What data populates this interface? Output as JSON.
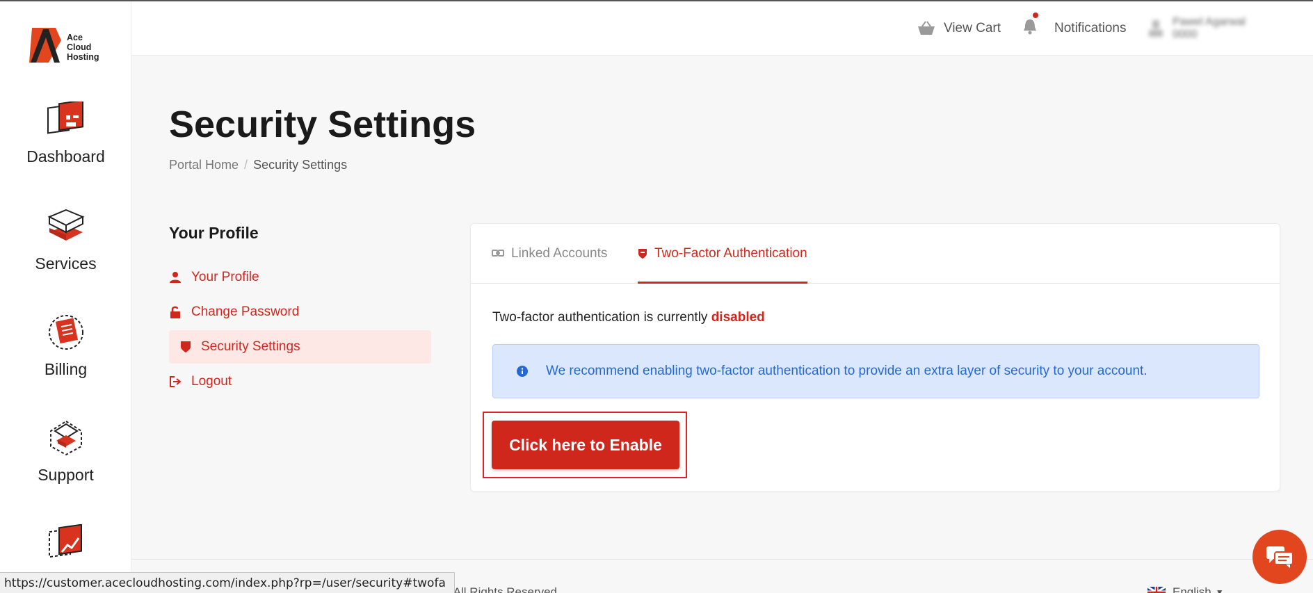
{
  "brand": {
    "logo_lines": [
      "Ace",
      "Cloud",
      "Hosting"
    ],
    "accent": "#d0271d"
  },
  "sidebar": {
    "items": [
      {
        "label": "Dashboard",
        "icon": "dashboard-icon"
      },
      {
        "label": "Services",
        "icon": "services-icon"
      },
      {
        "label": "Billing",
        "icon": "billing-icon"
      },
      {
        "label": "Support",
        "icon": "support-icon"
      },
      {
        "label": "",
        "icon": "reports-icon"
      }
    ]
  },
  "header": {
    "cart_label": "View Cart",
    "notifications_label": "Notifications",
    "user_name": "Pawel Agarwal",
    "user_sub": "0000"
  },
  "page": {
    "title": "Security Settings",
    "breadcrumb": [
      "Portal Home",
      "Security Settings"
    ]
  },
  "profile_menu": {
    "heading": "Your Profile",
    "items": [
      "Your Profile",
      "Change Password",
      "Security Settings",
      "Logout"
    ],
    "active_index": 2
  },
  "card": {
    "tabs": [
      "Linked Accounts",
      "Two-Factor Authentication"
    ],
    "active_tab": 1,
    "status_prefix": "Two-factor authentication is currently",
    "status_value": "disabled",
    "alert_text": "We recommend enabling two-factor authentication to provide an extra layer of security to your account.",
    "enable_button": "Click here to Enable"
  },
  "footer": {
    "copyright": "LLC. All Rights Reserved",
    "language": "English"
  },
  "statusbar": {
    "url": "https://customer.acecloudhosting.com/index.php?rp=/user/security#twofa"
  }
}
